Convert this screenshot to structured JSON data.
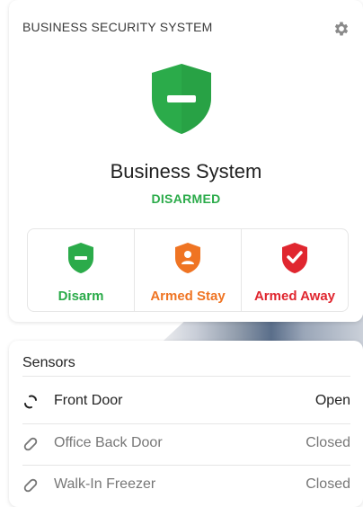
{
  "system": {
    "header_title": "BUSINESS SECURITY SYSTEM",
    "name": "Business System",
    "status": "DISARMED",
    "status_color": "#2bab4a",
    "settings_icon": "gear-icon",
    "hero_icon": "shield-disarmed-icon"
  },
  "modes": [
    {
      "label": "Disarm",
      "icon": "shield-minus-icon",
      "color": "#2bab4a"
    },
    {
      "label": "Armed Stay",
      "icon": "shield-person-icon",
      "color": "#ef7423"
    },
    {
      "label": "Armed Away",
      "icon": "shield-check-icon",
      "color": "#e0262f"
    }
  ],
  "sensors": {
    "title": "Sensors",
    "items": [
      {
        "name": "Front Door",
        "state": "Open",
        "icon": "open-link-icon"
      },
      {
        "name": "Office Back Door",
        "state": "Closed",
        "icon": "closed-link-icon"
      },
      {
        "name": "Walk-In Freezer",
        "state": "Closed",
        "icon": "closed-link-icon"
      }
    ]
  }
}
